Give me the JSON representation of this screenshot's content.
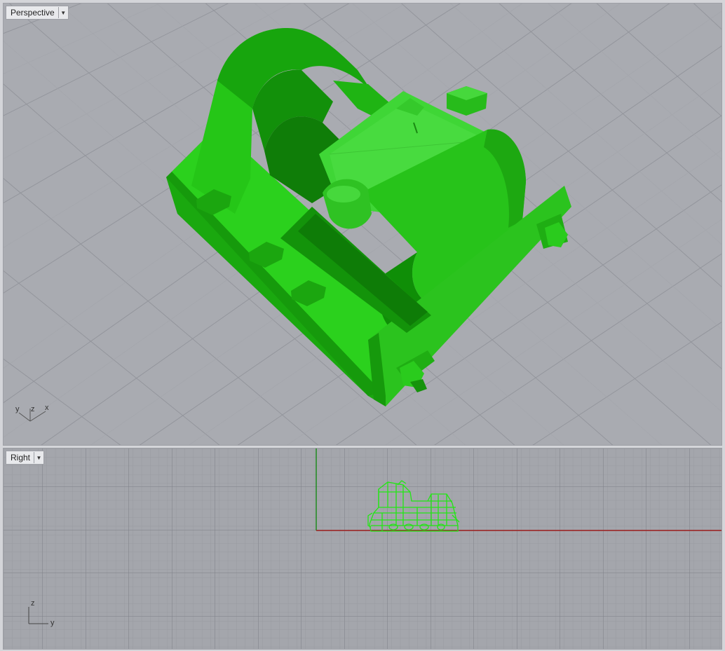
{
  "viewports": {
    "perspective": {
      "label": "Perspective",
      "axes": {
        "y": "y",
        "z": "z",
        "x": "x"
      }
    },
    "right": {
      "label": "Right",
      "axes": {
        "z": "z",
        "y": "y"
      }
    }
  },
  "icons": {
    "dropdown": "chevron-down-icon"
  },
  "colors": {
    "model_green": "#22c414",
    "grid_major": "#7f8088",
    "grid_minor": "#999ba1",
    "axis_red": "#a02020",
    "axis_green": "#1e8a1e",
    "background": "#a9abb1"
  }
}
